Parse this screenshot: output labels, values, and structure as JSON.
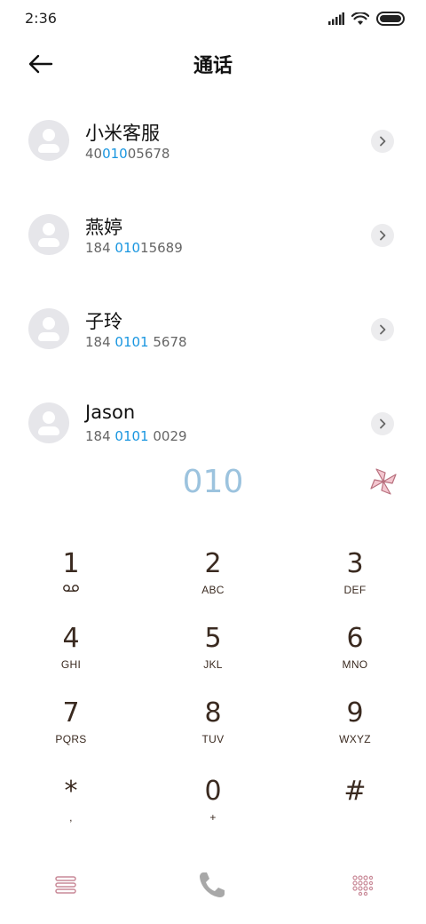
{
  "status_bar": {
    "time": "2:36"
  },
  "header": {
    "title": "通话"
  },
  "contacts": [
    {
      "name": "小米客服",
      "number": {
        "pre": "40",
        "hl": "010",
        "post": "05678"
      }
    },
    {
      "name": "燕婷",
      "number": {
        "pre": "184 ",
        "hl": "010",
        "post": "15689"
      }
    },
    {
      "name": "子玲",
      "number": {
        "pre": "184 ",
        "hl": "0101",
        "post": " 5678"
      }
    },
    {
      "name": "Jason",
      "number": {
        "pre": "184 ",
        "hl": "0101",
        "post": " 0029"
      }
    }
  ],
  "dialed_number": "010",
  "keypad": {
    "keys": [
      {
        "digit": "1",
        "letters": ""
      },
      {
        "digit": "2",
        "letters": "ABC"
      },
      {
        "digit": "3",
        "letters": "DEF"
      },
      {
        "digit": "4",
        "letters": "GHI"
      },
      {
        "digit": "5",
        "letters": "JKL"
      },
      {
        "digit": "6",
        "letters": "MNO"
      },
      {
        "digit": "7",
        "letters": "PQRS"
      },
      {
        "digit": "8",
        "letters": "TUV"
      },
      {
        "digit": "9",
        "letters": "WXYZ"
      },
      {
        "digit": "*",
        "letters": ","
      },
      {
        "digit": "0",
        "letters": "+"
      },
      {
        "digit": "#",
        "letters": ""
      }
    ]
  },
  "icons": {
    "back": "arrow-left-icon",
    "detail": "chevron-right-icon",
    "voicemail": "voicemail-icon",
    "menu": "menu-icon",
    "call": "phone-icon",
    "dialpad": "dialpad-icon"
  },
  "colors": {
    "highlight": "#1996e0",
    "dialed_text": "#9cc3de",
    "key_text": "#3a2a20",
    "accent_pink": "#c98a98",
    "call_icon": "#a8a8a8"
  }
}
